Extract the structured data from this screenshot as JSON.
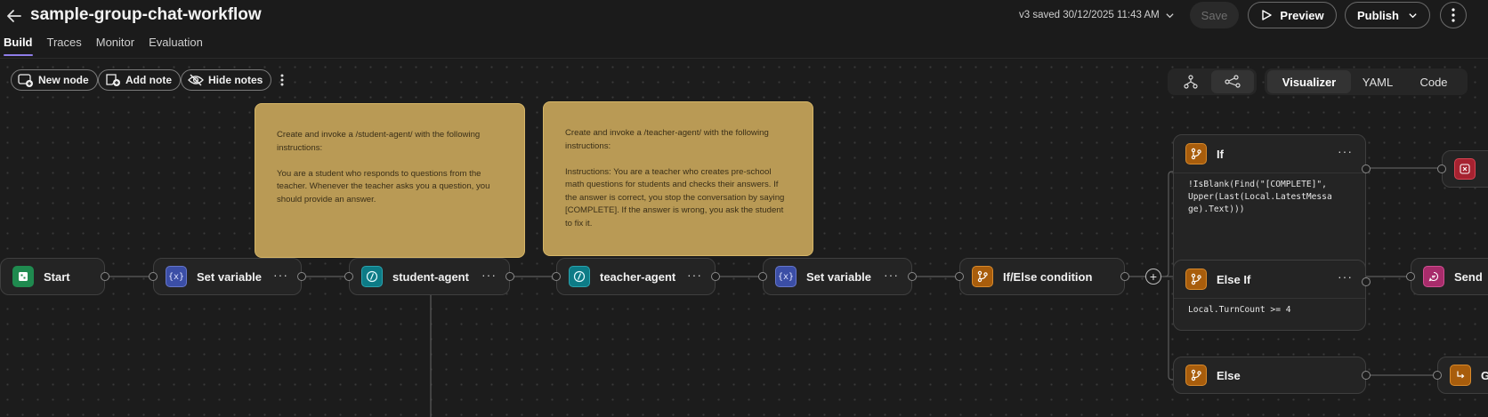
{
  "header": {
    "title": "sample-group-chat-workflow",
    "version_label": "v3 saved 30/12/2025 11:43 AM",
    "save_label": "Save",
    "preview_label": "Preview",
    "publish_label": "Publish"
  },
  "tabs": [
    {
      "label": "Build",
      "active": true
    },
    {
      "label": "Traces",
      "active": false
    },
    {
      "label": "Monitor",
      "active": false
    },
    {
      "label": "Evaluation",
      "active": false
    }
  ],
  "toolbar": {
    "new_node": "New node",
    "add_note": "Add note",
    "hide_notes": "Hide notes"
  },
  "view_modes": [
    {
      "label": "Visualizer",
      "active": true
    },
    {
      "label": "YAML",
      "active": false
    },
    {
      "label": "Code",
      "active": false
    }
  ],
  "notes": [
    {
      "text": "Create and invoke a /student-agent/ with the following instructions:\n\nYou are a student who responds to questions from the teacher. Whenever the teacher asks you a question, you should provide an answer."
    },
    {
      "text": "Create and invoke a /teacher-agent/ with the following instructions:\n\nInstructions: You are a teacher who creates pre-school math questions for students and checks their answers. If the answer is correct, you stop the conversation by saying [COMPLETE]. If the answer is wrong, you ask the student to fix it."
    }
  ],
  "nodes": {
    "start": "Start",
    "set_variable_1": "Set variable",
    "student_agent": "student-agent",
    "teacher_agent": "teacher-agent",
    "set_variable_2": "Set variable",
    "if_else": "If/Else condition"
  },
  "branches": {
    "if": {
      "label": "If",
      "code": "!IsBlank(Find(\"[COMPLETE]\",\nUpper(Last(Local.LatestMessa\nge).Text)))"
    },
    "else_if": {
      "label": "Else If",
      "code": "Local.TurnCount >= 4"
    },
    "else": {
      "label": "Else"
    }
  },
  "partial_nodes": {
    "send": "Send",
    "cut_label": "G"
  },
  "icons": {
    "back": "arrow-left-icon",
    "chevron": "chevron-down-icon",
    "preview": "play-icon",
    "kebab": "more-vertical-icon",
    "new_node": "add-node-icon",
    "add_note": "add-note-icon",
    "hide_notes": "eye-off-icon",
    "layout_tree": "tree-layout-icon",
    "layout_graph": "graph-layout-icon",
    "variable": "variable-icon",
    "agent": "agent-icon",
    "branch": "branch-icon"
  },
  "colors": {
    "accent": "#8f7de8",
    "note": "#b99a55",
    "start": "#1f8a4f",
    "variable": "#3b4ea6",
    "agent": "#0d7b86",
    "condition": "#a85d0c",
    "end": "#a62230",
    "message": "#a82c6b"
  }
}
